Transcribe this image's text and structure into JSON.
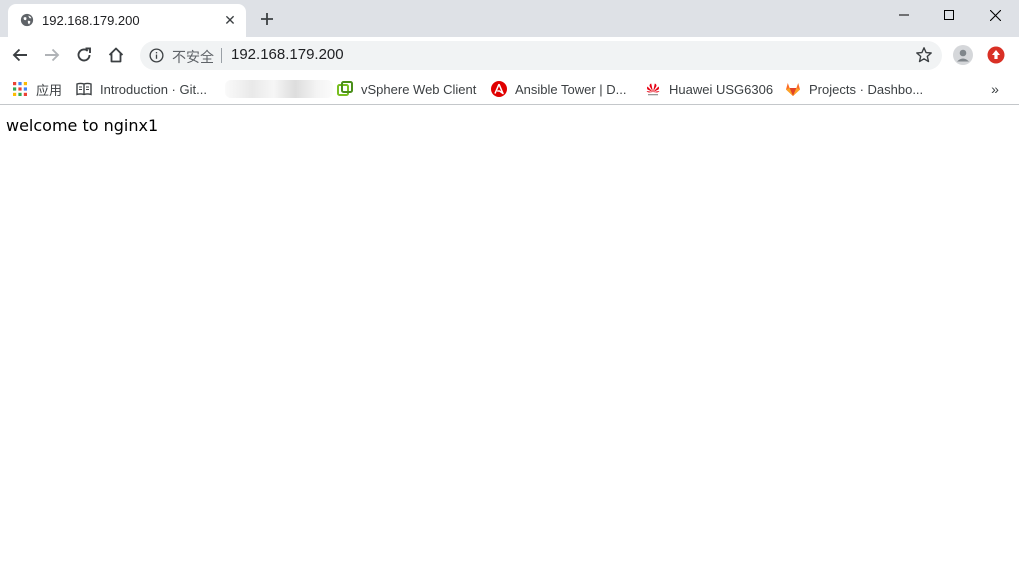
{
  "tab": {
    "title": "192.168.179.200",
    "close_glyph": "✕",
    "new_tab_icon": "plus-icon"
  },
  "toolbar": {
    "security_label": "不安全",
    "url": "192.168.179.200"
  },
  "bookmarks": {
    "apps_label": "应用",
    "items": [
      {
        "label": "Introduction · Git...",
        "icon": "book-icon"
      },
      {
        "label": "vSphere Web Client",
        "icon": "vsphere-icon"
      },
      {
        "label": "Ansible Tower | D...",
        "icon": "ansible-icon"
      },
      {
        "label": "Huawei USG6306",
        "icon": "huawei-icon"
      },
      {
        "label": "Projects · Dashbo...",
        "icon": "gitlab-icon"
      }
    ],
    "overflow_glyph": "»"
  },
  "page": {
    "text": "welcome to nginx1"
  },
  "colors": {
    "tabstrip": "#dee1e6",
    "omnibox": "#f1f3f4",
    "ansible_red": "#e00000",
    "gitlab_orange": "#fc6d26",
    "extension_red": "#d93025"
  }
}
